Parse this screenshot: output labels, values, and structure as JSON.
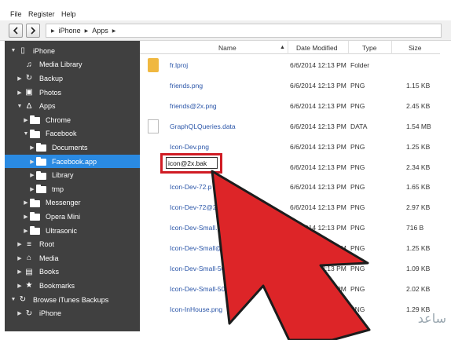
{
  "menu": [
    "File",
    "Register",
    "Help"
  ],
  "nav": {
    "back_icon": "chevron-left-icon",
    "forward_icon": "chevron-right-icon"
  },
  "breadcrumb": [
    "iPhone",
    "Apps"
  ],
  "sidebar": {
    "items": [
      {
        "label": "iPhone",
        "icon": "phone-icon",
        "arrow": "down",
        "indent": 0
      },
      {
        "label": "Media Library",
        "icon": "music-icon",
        "arrow": "",
        "indent": 1
      },
      {
        "label": "Backup",
        "icon": "backup-icon",
        "arrow": "right",
        "indent": 1
      },
      {
        "label": "Photos",
        "icon": "photo-icon",
        "arrow": "right",
        "indent": 1
      },
      {
        "label": "Apps",
        "icon": "apps-icon",
        "arrow": "down",
        "indent": 1
      },
      {
        "label": "Chrome",
        "icon": "folder-icon",
        "arrow": "right",
        "indent": 2
      },
      {
        "label": "Facebook",
        "icon": "folder-icon",
        "arrow": "down",
        "indent": 2
      },
      {
        "label": "Documents",
        "icon": "folder-icon",
        "arrow": "right",
        "indent": 3
      },
      {
        "label": "Facebook.app",
        "icon": "folder-icon",
        "arrow": "right",
        "indent": 3,
        "selected": true
      },
      {
        "label": "Library",
        "icon": "folder-icon",
        "arrow": "right",
        "indent": 3
      },
      {
        "label": "tmp",
        "icon": "folder-icon",
        "arrow": "right",
        "indent": 3
      },
      {
        "label": "Messenger",
        "icon": "folder-icon",
        "arrow": "right",
        "indent": 2
      },
      {
        "label": "Opera Mini",
        "icon": "folder-icon",
        "arrow": "right",
        "indent": 2
      },
      {
        "label": "Ultrasonic",
        "icon": "folder-icon",
        "arrow": "right",
        "indent": 2
      },
      {
        "label": "Root",
        "icon": "root-icon",
        "arrow": "right",
        "indent": 1
      },
      {
        "label": "Media",
        "icon": "media-icon",
        "arrow": "right",
        "indent": 1
      },
      {
        "label": "Books",
        "icon": "book-icon",
        "arrow": "right",
        "indent": 1
      },
      {
        "label": "Bookmarks",
        "icon": "star-icon",
        "arrow": "right",
        "indent": 1
      },
      {
        "label": "Browse iTunes Backups",
        "icon": "backup-icon",
        "arrow": "down",
        "indent": 0
      },
      {
        "label": "iPhone",
        "icon": "backup-icon",
        "arrow": "right",
        "indent": 1
      }
    ]
  },
  "columns": {
    "name": "Name",
    "date": "Date Modified",
    "type": "Type",
    "size": "Size"
  },
  "files": [
    {
      "name": "fr.lproj",
      "date": "6/6/2014 12:13 PM",
      "type": "Folder",
      "size": "",
      "icon": "folder-icon"
    },
    {
      "name": "friends.png",
      "date": "6/6/2014 12:13 PM",
      "type": "PNG",
      "size": "1.15 KB",
      "icon": ""
    },
    {
      "name": "friends@2x.png",
      "date": "6/6/2014 12:13 PM",
      "type": "PNG",
      "size": "2.45 KB",
      "icon": ""
    },
    {
      "name": "GraphQLQueries.data",
      "date": "6/6/2014 12:13 PM",
      "type": "DATA",
      "size": "1.54 MB",
      "icon": "document-icon"
    },
    {
      "name": "Icon-Dev.png",
      "date": "6/6/2014 12:13 PM",
      "type": "PNG",
      "size": "1.25 KB",
      "icon": ""
    },
    {
      "name": "",
      "date": "6/6/2014 12:13 PM",
      "type": "PNG",
      "size": "2.34 KB",
      "icon": "",
      "rename_value": "icon@2x.bak"
    },
    {
      "name": "Icon-Dev-72.p",
      "date": "6/6/2014 12:13 PM",
      "type": "PNG",
      "size": "1.65 KB",
      "icon": ""
    },
    {
      "name": "Icon-Dev-72@2x",
      "date": "6/6/2014 12:13 PM",
      "type": "PNG",
      "size": "2.97 KB",
      "icon": ""
    },
    {
      "name": "Icon-Dev-Small.png",
      "date": "6/6/2014 12:13 PM",
      "type": "PNG",
      "size": "716 B",
      "icon": ""
    },
    {
      "name": "Icon-Dev-Small@2x.p",
      "date": "6/6/2014 12:13 PM",
      "type": "PNG",
      "size": "1.25 KB",
      "icon": ""
    },
    {
      "name": "Icon-Dev-Small-50.png",
      "date": "6/6/2014 12:13 PM",
      "type": "PNG",
      "size": "1.09 KB",
      "icon": ""
    },
    {
      "name": "Icon-Dev-Small-50@2x.p",
      "date": "6/6/2014 12:13 PM",
      "type": "PNG",
      "size": "2.02 KB",
      "icon": ""
    },
    {
      "name": "Icon-InHouse.png",
      "date": "6/6/2014 12:13 PM",
      "type": "PNG",
      "size": "1.29 KB",
      "icon": ""
    }
  ],
  "colors": {
    "sidebar_bg": "#404040",
    "selected": "#2a8ae2",
    "highlight_red": "#d01c24",
    "link_blue": "#2a55a8"
  },
  "annotation": {
    "pointer_icon": "red-arrow-pointer-icon"
  }
}
